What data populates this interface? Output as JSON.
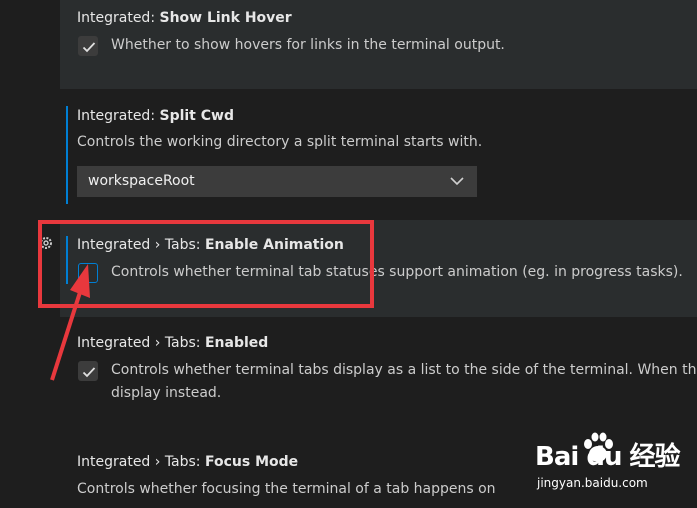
{
  "settings": [
    {
      "category": "Integrated: ",
      "name": "Show Link Hover",
      "description": "Whether to show hovers for links in the terminal output.",
      "checked": true
    },
    {
      "category": "Integrated: ",
      "name": "Split Cwd",
      "description": "Controls the working directory a split terminal starts with.",
      "value": "workspaceRoot"
    },
    {
      "category": "Integrated › Tabs: ",
      "name": "Enable Animation",
      "description": "Controls whether terminal tab statuses support animation (eg. in progress tasks).",
      "checked": false
    },
    {
      "category": "Integrated › Tabs: ",
      "name": "Enabled",
      "description_line1": "Controls whether terminal tabs display as a list to the side of the terminal. When th",
      "description_line2": "display instead.",
      "checked": true
    },
    {
      "category": "Integrated › Tabs: ",
      "name": "Focus Mode",
      "description": "Controls whether focusing the terminal of a tab happens on"
    }
  ],
  "watermark": {
    "logo": "Bai du 经验",
    "url": "jingyan.baidu.com"
  },
  "colors": {
    "accent": "#007fd4",
    "highlight": "#e8383d",
    "background": "#1e1e1e"
  },
  "icons": {
    "checkbox": "check-icon",
    "dropdown": "chevron-down-icon",
    "gear": "gear-icon",
    "annotation": "arrow-icon"
  }
}
